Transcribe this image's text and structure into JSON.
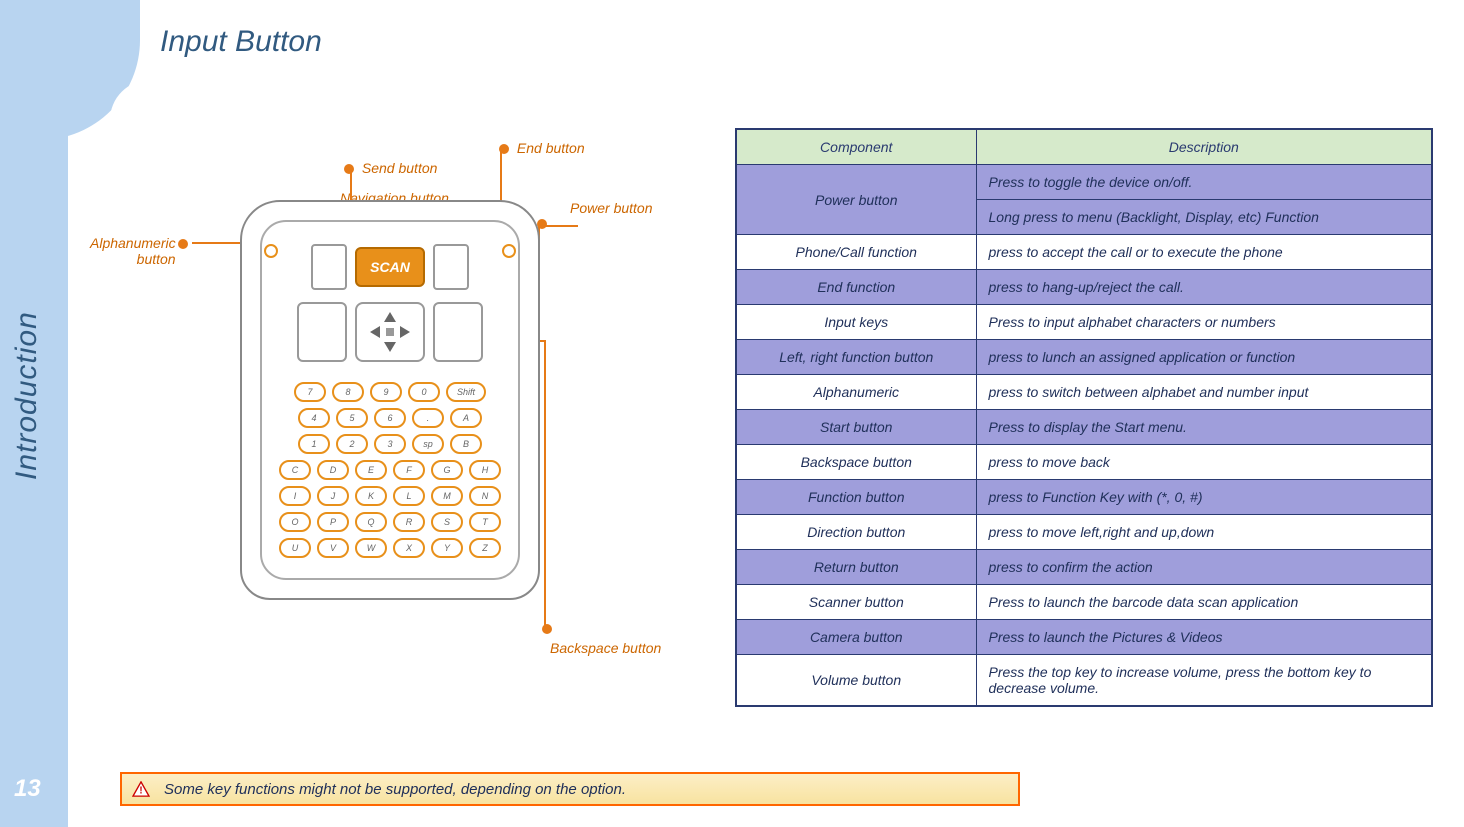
{
  "page": {
    "title": "Input Button",
    "sidebar_label": "Introduction",
    "number": "13"
  },
  "callouts": {
    "send": "Send button",
    "end": "End button",
    "nav": "Navigation button",
    "power": "Power button",
    "alpha_l1": "Alphanumeric",
    "alpha_l2": "button",
    "backspace": "Backspace button"
  },
  "table": {
    "head_component": "Component",
    "head_description": "Description",
    "rows": [
      {
        "component": "Power button",
        "description": "Press to toggle the device on/off.",
        "rowspan": 2,
        "alt": "odd"
      },
      {
        "component": "",
        "description": "Long press to menu (Backlight, Display, etc) Function",
        "alt": "odd",
        "cont": true
      },
      {
        "component": "Phone/Call function",
        "description": "press to accept the call or to execute the phone",
        "alt": "even"
      },
      {
        "component": "End function",
        "description": "press to hang-up/reject the call.",
        "alt": "odd"
      },
      {
        "component": "Input keys",
        "description": "Press to input alphabet characters or numbers",
        "alt": "even"
      },
      {
        "component": "Left, right function button",
        "description": "press to lunch an assigned application or function",
        "alt": "odd"
      },
      {
        "component": "Alphanumeric",
        "description": "press to switch between alphabet and number input",
        "alt": "even"
      },
      {
        "component": "Start button",
        "description": "Press to display the Start menu.",
        "alt": "odd"
      },
      {
        "component": "Backspace button",
        "description": "press to move back",
        "alt": "even"
      },
      {
        "component": "Function button",
        "description": "press to Function Key with (*, 0, #)",
        "alt": "odd"
      },
      {
        "component": "Direction  button",
        "description": "press to move  left,right and up,down",
        "alt": "even"
      },
      {
        "component": "Return button",
        "description": "press to confirm the action",
        "alt": "odd"
      },
      {
        "component": "Scanner button",
        "description": "Press to launch the barcode data scan application",
        "alt": "even"
      },
      {
        "component": "Camera button",
        "description": "Press to launch the Pictures & Videos",
        "alt": "odd"
      },
      {
        "component": "Volume button",
        "description": "Press the top key to increase volume, press the bottom key to decrease volume.",
        "alt": "even"
      }
    ]
  },
  "warning": {
    "text": "Some key functions might not be supported, depending on the option."
  },
  "device": {
    "scan_label": "SCAN"
  }
}
